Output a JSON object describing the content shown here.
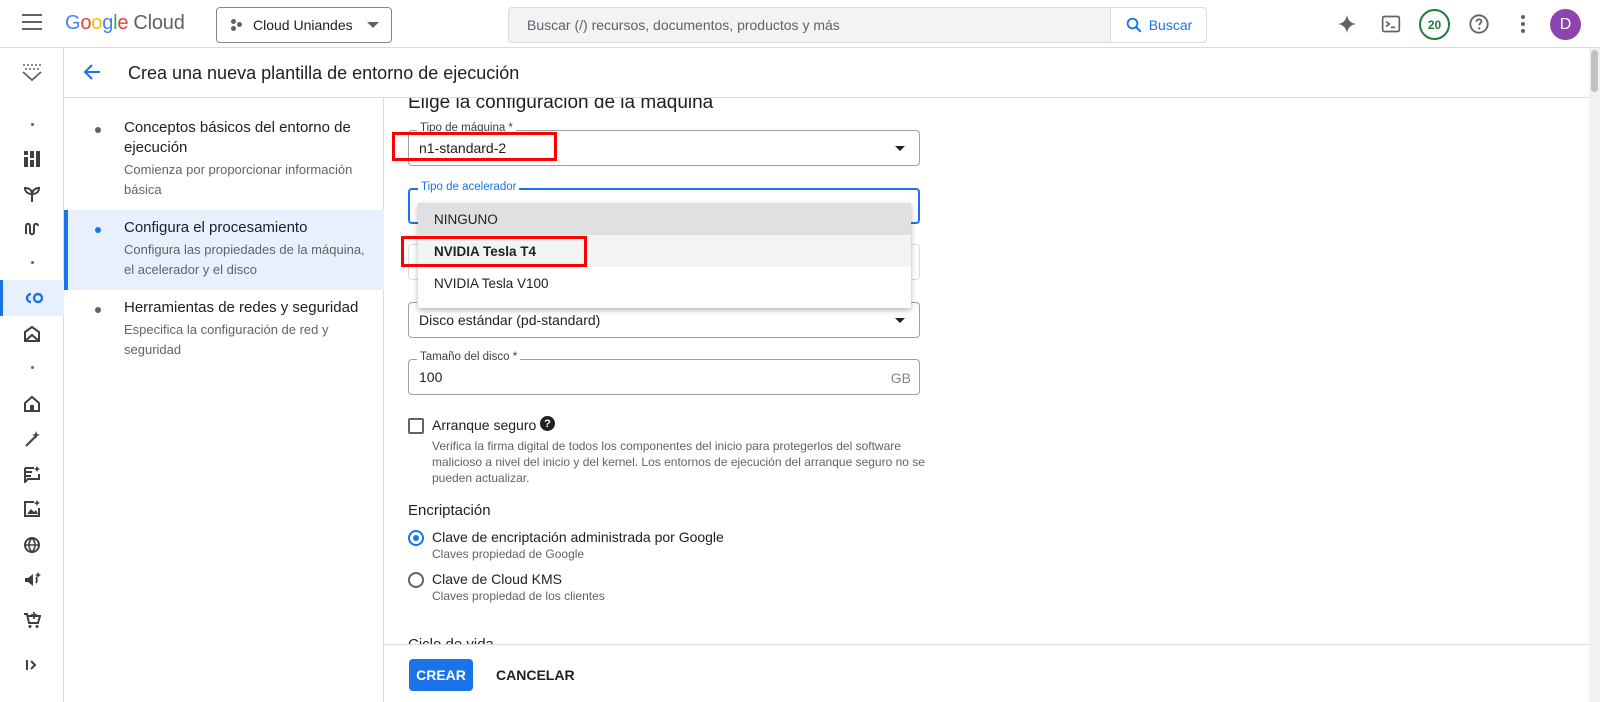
{
  "header": {
    "logo": {
      "G": "G",
      "o1": "o",
      "o2": "o",
      "g": "g",
      "l": "l",
      "e": "e",
      "cloud": "Cloud"
    },
    "project": "Cloud Uniandes",
    "search_placeholder": "Buscar (/) recursos, documentos, productos y más",
    "search_button": "Buscar",
    "notifications_count": "20",
    "avatar_initial": "D",
    "icons": [
      "menu-icon",
      "sparkle-icon",
      "terminal-icon",
      "help-icon",
      "more-vert-icon"
    ]
  },
  "rail": {
    "icons": [
      "vertex-logo-icon",
      "dashboard-icon",
      "sprout-icon",
      "pipeline-icon",
      "colab-icon",
      "model-garden-icon",
      "home-icon",
      "magic-wand-icon",
      "chat-spark-icon",
      "image-spark-icon",
      "globe-icon",
      "speech-icon",
      "cart-icon",
      "expand-icon"
    ]
  },
  "page": {
    "title": "Crea una nueva plantilla de entorno de ejecución"
  },
  "steps": [
    {
      "title": "Conceptos básicos del entorno de ejecución",
      "desc": "Comienza por proporcionar información básica"
    },
    {
      "title": "Configura el procesamiento",
      "desc": "Configura las propiedades de la máquina, el acelerador y el disco"
    },
    {
      "title": "Herramientas de redes y seguridad",
      "desc": "Especifica la configuración de red y seguridad"
    }
  ],
  "form": {
    "section_title": "Elige la configuración de la máquina",
    "machine_type": {
      "label": "Tipo de máquina *",
      "value": "n1-standard-2"
    },
    "accelerator": {
      "label": "Tipo de acelerador",
      "options": [
        "NINGUNO",
        "NVIDIA Tesla T4",
        "NVIDIA Tesla V100"
      ],
      "selected": "NINGUNO",
      "highlighted": "NVIDIA Tesla T4"
    },
    "disk_type": {
      "value": "Disco estándar (pd-standard)"
    },
    "disk_size": {
      "label": "Tamaño del disco *",
      "value": "100",
      "unit": "GB"
    },
    "secure_boot": {
      "label": "Arranque seguro",
      "checked": false,
      "desc": "Verifica la firma digital de todos los componentes del inicio para protegerlos del software malicioso a nivel del inicio y del kernel. Los entornos de ejecución del arranque seguro no se pueden actualizar."
    },
    "encryption": {
      "title": "Encriptación",
      "options": [
        {
          "label": "Clave de encriptación administrada por Google",
          "sub": "Claves propiedad de Google",
          "selected": true
        },
        {
          "label": "Clave de Cloud KMS",
          "sub": "Claves propiedad de los clientes",
          "selected": false
        }
      ]
    },
    "next_section_cut": "Ciclo de vida"
  },
  "footer": {
    "create": "CREAR",
    "cancel": "CANCELAR"
  },
  "colors": {
    "accent": "#1a73e8",
    "highlight_box": "#ff0000",
    "project_badge": "#188038",
    "avatar": "#8e44ad"
  }
}
